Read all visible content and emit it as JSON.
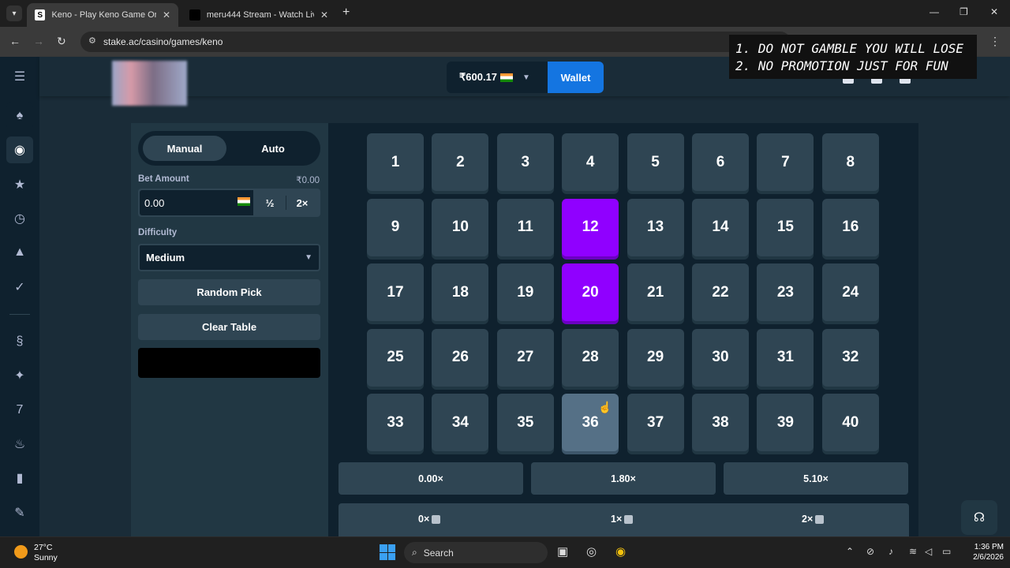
{
  "browser": {
    "tabs": [
      {
        "title": "Keno - Play Keno Game Online",
        "favicon": "stake-s-icon",
        "active": true
      },
      {
        "title": "meru444 Stream - Watch Live o",
        "favicon": "stream-favicon",
        "active": false
      }
    ],
    "url": "stake.ac/casino/games/keno"
  },
  "overlay": {
    "line1": "1. DO NOT GAMBLE YOU WILL LOSE",
    "line2": "2. NO PROMOTION JUST FOR FUN"
  },
  "header": {
    "balance": "₹600.17",
    "wallet_label": "Wallet"
  },
  "panel": {
    "mode_manual": "Manual",
    "mode_auto": "Auto",
    "bet_amount_label": "Bet Amount",
    "bet_amount_value_label": "₹0.00",
    "bet_input_value": "0.00",
    "half_label": "½",
    "double_label": "2×",
    "difficulty_label": "Difficulty",
    "difficulty_value": "Medium",
    "random_pick_label": "Random Pick",
    "clear_table_label": "Clear Table"
  },
  "board": {
    "selected": [
      12,
      20
    ],
    "hovered": 36,
    "multipliers": [
      "0.00×",
      "1.80×",
      "5.10×"
    ],
    "hits": [
      "0×",
      "1×",
      "2×"
    ]
  },
  "taskbar": {
    "temperature": "27°C",
    "weather": "Sunny",
    "search_placeholder": "Search",
    "time": "1:36 PM",
    "date": "2/6/2026"
  },
  "colors": {
    "selected_tile": "#9000ff",
    "tile": "#2f4553",
    "wallet": "#1475e1",
    "background": "#1a2c38"
  }
}
